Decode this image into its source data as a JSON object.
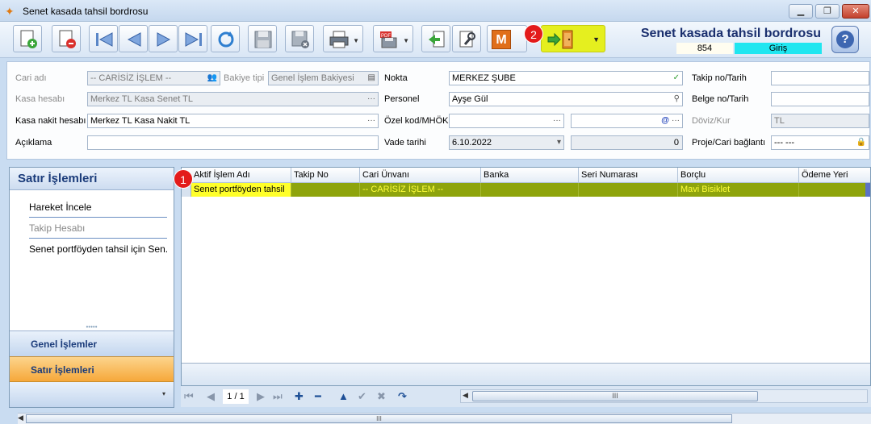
{
  "window": {
    "title": "Senet kasada tahsil bordrosu",
    "controls": {
      "minimize": "▁",
      "maximize": "❐",
      "close": "✕"
    }
  },
  "toolbar": {
    "buttons": [
      {
        "name": "new-button",
        "icon": "new-document-icon"
      },
      {
        "name": "delete-button",
        "icon": "delete-document-icon"
      },
      {
        "name": "first-record-button",
        "icon": "first-icon"
      },
      {
        "name": "prev-record-button",
        "icon": "prev-icon"
      },
      {
        "name": "next-record-button",
        "icon": "next-icon"
      },
      {
        "name": "last-record-button",
        "icon": "last-icon"
      },
      {
        "name": "refresh-button",
        "icon": "refresh-icon"
      },
      {
        "name": "save-button",
        "icon": "save-icon"
      },
      {
        "name": "save-close-button",
        "icon": "save-close-icon"
      },
      {
        "name": "print-button",
        "icon": "printer-icon"
      },
      {
        "name": "pdf-export-button",
        "icon": "pdf-icon"
      },
      {
        "name": "import-button",
        "icon": "import-icon"
      },
      {
        "name": "tools-button",
        "icon": "wrench-icon"
      },
      {
        "name": "m-button",
        "icon": "m-icon",
        "label": "M"
      },
      {
        "name": "exit-button",
        "icon": "exit-door-icon"
      }
    ],
    "dropdown_caret": "▼",
    "accent_highlight": "#e5ef1f"
  },
  "document": {
    "title": "Senet kasada tahsil bordrosu",
    "number": "854",
    "status": "Giriş",
    "status_color": "#20e6f0"
  },
  "help": {
    "label": "?"
  },
  "badges": {
    "one": "1",
    "two": "2",
    "color": "#e31b1b"
  },
  "form": {
    "cari_adi": {
      "label": "Cari adı",
      "value": "-- CARİSİZ İŞLEM --"
    },
    "bakiye_tipi": {
      "label": "Bakiye tipi",
      "value": "Genel İşlem Bakiyesi"
    },
    "kasa_hesabi": {
      "label": "Kasa hesabı",
      "value": "Merkez TL Kasa Senet TL"
    },
    "kasa_nakit": {
      "label": "Kasa nakit hesabı",
      "value": "Merkez TL Kasa Nakit TL"
    },
    "aciklama": {
      "label": "Açıklama",
      "value": ""
    },
    "nokta": {
      "label": "Nokta",
      "value": "MERKEZ ŞUBE"
    },
    "personel": {
      "label": "Personel",
      "value": "Ayşe Gül"
    },
    "ozel_kod": {
      "label": "Özel kod/MHÖK",
      "value": "",
      "value2": ""
    },
    "vade_tarihi": {
      "label": "Vade tarihi",
      "value": "6.10.2022",
      "amount": "0"
    },
    "takip_no": {
      "label": "Takip no/Tarih",
      "value": ""
    },
    "belge_no": {
      "label": "Belge no/Tarih",
      "value": ""
    },
    "doviz_kur": {
      "label": "Döviz/Kur",
      "value": "TL"
    },
    "proje": {
      "label": "Proje/Cari bağlantı",
      "value": "--- ---"
    },
    "ellipsis": "···",
    "check": "✓",
    "at": "@",
    "caret": "▾"
  },
  "side_panel": {
    "title": "Satır İşlemleri",
    "items": [
      {
        "label": "Hareket İncele",
        "enabled": true
      },
      {
        "label": "Takip Hesabı",
        "enabled": false
      },
      {
        "label": "Senet portföyden tahsil için Sen...",
        "enabled": true
      }
    ],
    "grip": "•••••",
    "nav": [
      {
        "label": "Genel İşlemler",
        "active": false
      },
      {
        "label": "Satır İşlemleri",
        "active": true
      }
    ],
    "nav_caret": "▾"
  },
  "grid": {
    "columns": [
      "Aktif İşlem Adı",
      "Takip No",
      "Cari Ünvanı",
      "Banka",
      "Seri Numarası",
      "Borçlu",
      "Ödeme Yeri"
    ],
    "rows": [
      [
        "Senet portföyden tahsil",
        "",
        "-- CARİSİZ İŞLEM --",
        "",
        "",
        "Mavi Bisiklet",
        ""
      ]
    ],
    "selected_row_color": "#8ea40c"
  },
  "navigator": {
    "page": "1 / 1",
    "first": "⏮",
    "prev": "◀",
    "next": "▶",
    "last": "⏭",
    "add": "✚",
    "remove": "━",
    "up": "▲",
    "confirm": "✔",
    "cancel": "✖",
    "refresh": "↷",
    "scroll_left": "◀",
    "scroll_grip": "III"
  }
}
